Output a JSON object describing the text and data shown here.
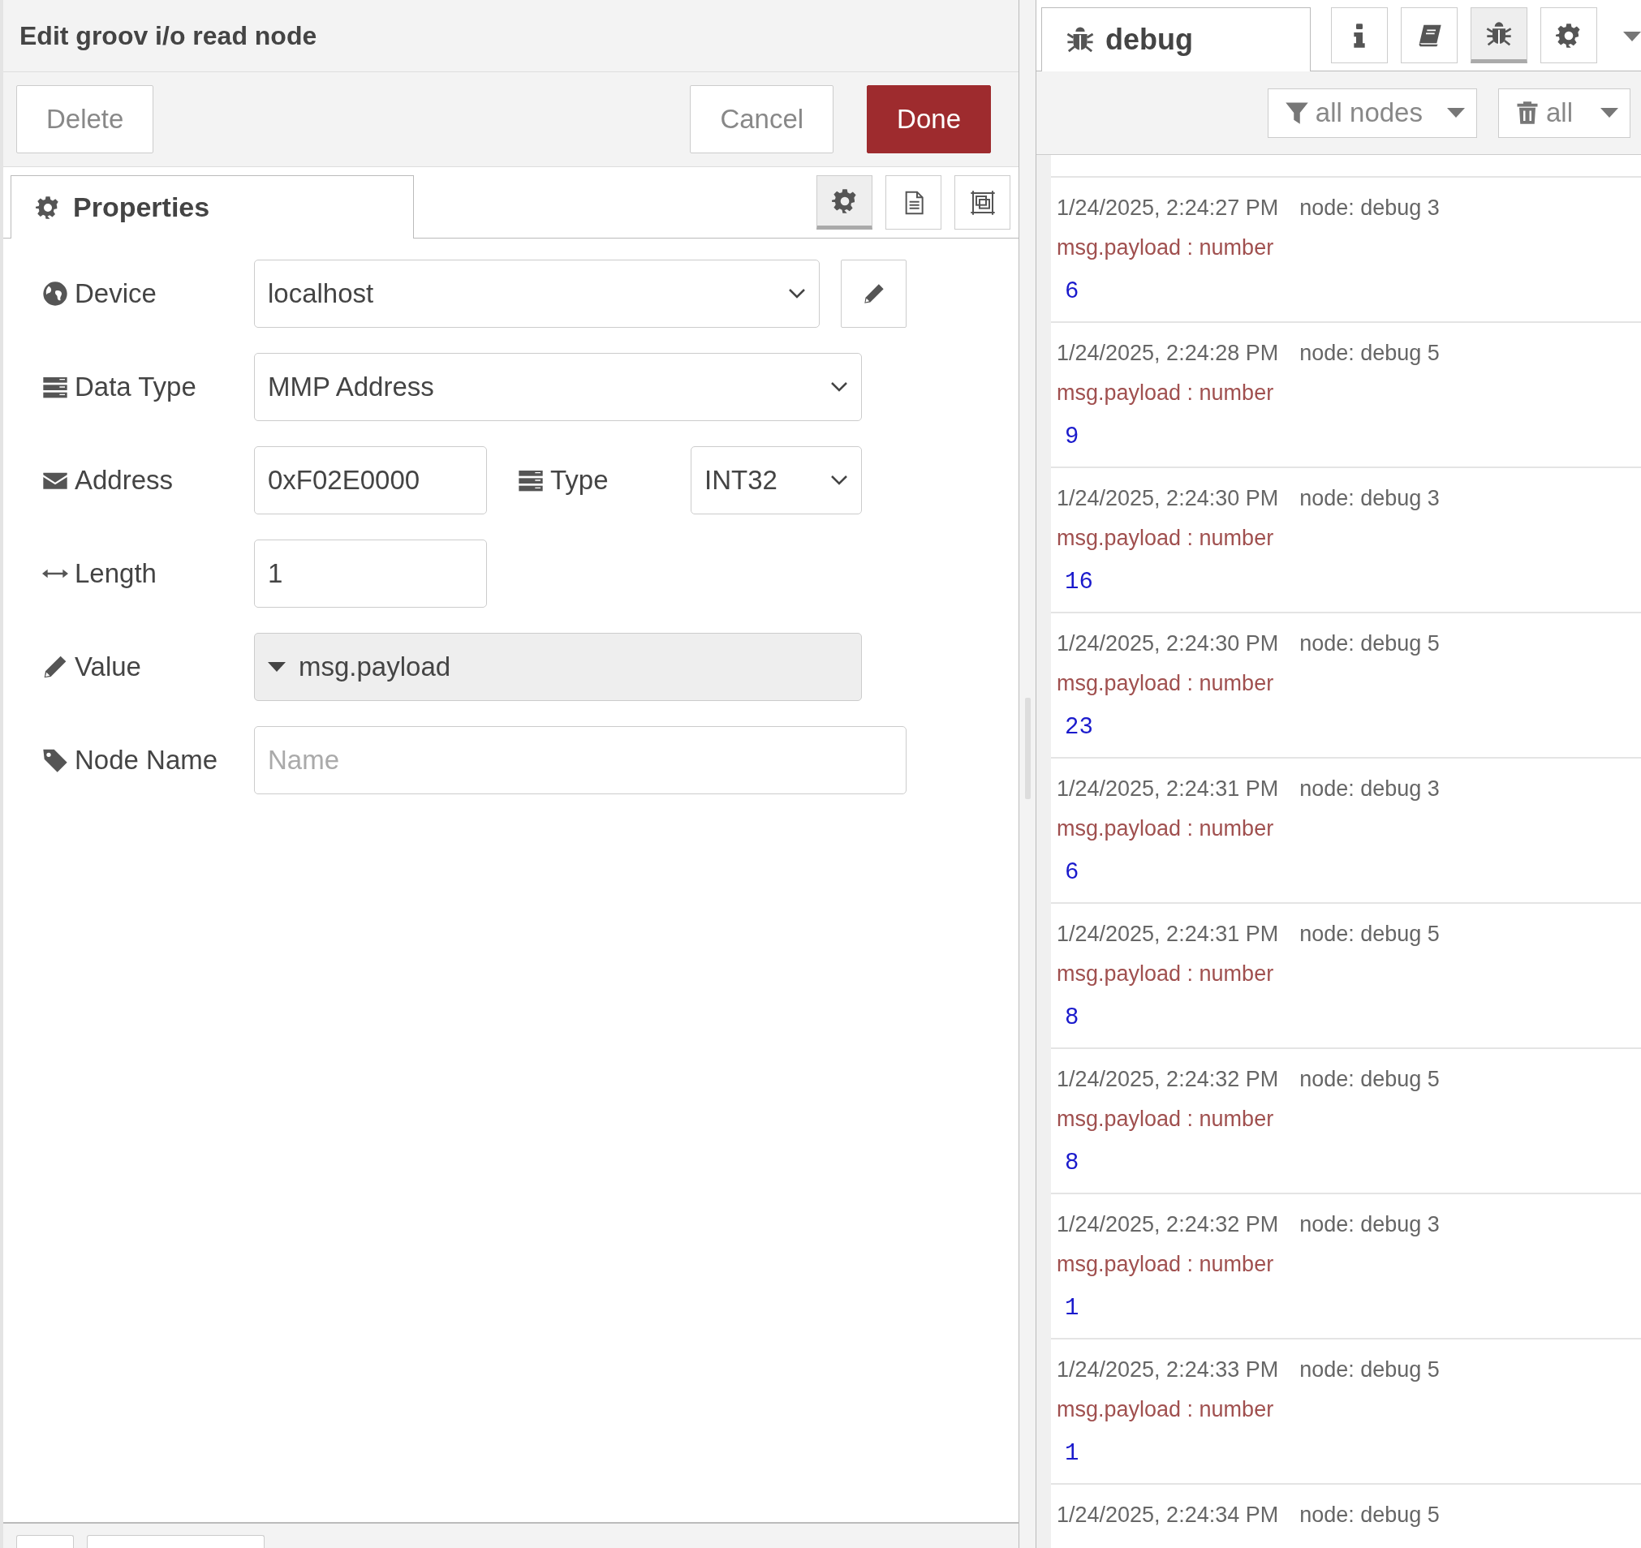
{
  "dialog": {
    "title": "Edit groov i/o read node",
    "buttons": [
      {
        "label": "Delete",
        "kind": "plain"
      },
      {
        "label": "Cancel",
        "kind": "plain"
      },
      {
        "label": "Done",
        "kind": "primary"
      }
    ],
    "tabs": [
      {
        "label": "Properties",
        "kind": "gear",
        "selected": true
      }
    ],
    "icon_tabs": [
      {
        "kind": "gear",
        "selected": true
      },
      {
        "kind": "document",
        "selected": false
      },
      {
        "kind": "frame",
        "selected": false
      }
    ],
    "fields": [
      {
        "label": "Device",
        "kind": "select_edit",
        "value": "localhost"
      },
      {
        "label": "Data Type",
        "kind": "select",
        "value": "MMP Address"
      },
      {
        "label": "Address",
        "kind": "short_input",
        "value": "0xF02E0000",
        "extra": {
          "label": "Type",
          "kind": "small_select",
          "value": "INT32"
        }
      },
      {
        "label": "Length",
        "kind": "short_input",
        "value": "1"
      },
      {
        "label": "Value",
        "kind": "typed",
        "value": "msg.payload"
      },
      {
        "label": "Node Name",
        "kind": "input",
        "placeholder": "Name"
      }
    ]
  },
  "sidebar": {
    "tabs": [
      {
        "label": "debug",
        "kind": "bug",
        "selected": true
      }
    ],
    "icon_tabs": [
      {
        "kind": "info",
        "selected": false
      },
      {
        "kind": "book",
        "selected": false
      },
      {
        "kind": "bug",
        "selected": true
      },
      {
        "kind": "gear",
        "selected": false
      }
    ],
    "filters": [
      {
        "label": "all nodes",
        "kind": "filter"
      },
      {
        "label": "all",
        "kind": "trash"
      }
    ],
    "messages": [
      {
        "time": "1/24/2025, 2:24:27 PM",
        "node": "node: debug 3",
        "type": "msg.payload : number",
        "value": "6"
      },
      {
        "time": "1/24/2025, 2:24:28 PM",
        "node": "node: debug 5",
        "type": "msg.payload : number",
        "value": "9"
      },
      {
        "time": "1/24/2025, 2:24:30 PM",
        "node": "node: debug 3",
        "type": "msg.payload : number",
        "value": "16"
      },
      {
        "time": "1/24/2025, 2:24:30 PM",
        "node": "node: debug 5",
        "type": "msg.payload : number",
        "value": "23"
      },
      {
        "time": "1/24/2025, 2:24:31 PM",
        "node": "node: debug 3",
        "type": "msg.payload : number",
        "value": "6"
      },
      {
        "time": "1/24/2025, 2:24:31 PM",
        "node": "node: debug 5",
        "type": "msg.payload : number",
        "value": "8"
      },
      {
        "time": "1/24/2025, 2:24:32 PM",
        "node": "node: debug 5",
        "type": "msg.payload : number",
        "value": "8"
      },
      {
        "time": "1/24/2025, 2:24:32 PM",
        "node": "node: debug 3",
        "type": "msg.payload : number",
        "value": "1"
      },
      {
        "time": "1/24/2025, 2:24:33 PM",
        "node": "node: debug 5",
        "type": "msg.payload : number",
        "value": "1"
      },
      {
        "time": "1/24/2025, 2:24:34 PM",
        "node": "node: debug 5"
      }
    ]
  }
}
